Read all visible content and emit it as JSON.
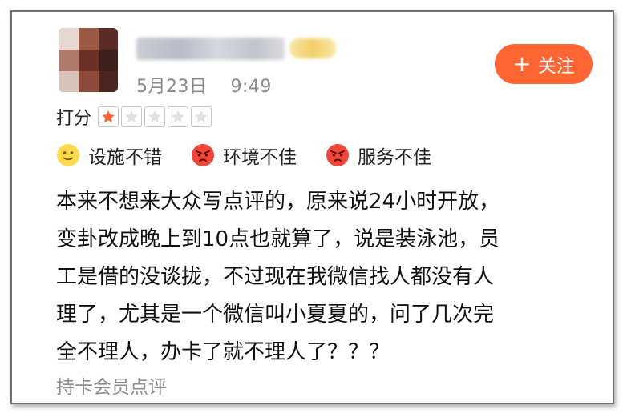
{
  "post": {
    "date": "5月23日",
    "time": "9:49"
  },
  "follow_button": {
    "label": "关注"
  },
  "rating": {
    "label": "打分",
    "stars_filled": 1,
    "stars_total": 5
  },
  "tags": [
    {
      "icon": "smile-face-icon",
      "label": "设施不错"
    },
    {
      "icon": "angry-face-icon",
      "label": "环境不佳"
    },
    {
      "icon": "angry-face-icon",
      "label": "服务不佳"
    }
  ],
  "review": {
    "lines": [
      "本来不想来大众写点评的，原来说24小时开放，",
      "变卦改成晚上到10点也就算了，说是装泳池，员",
      "工是借的没谈拢，不过现在我微信找人都没有人",
      "理了，尤其是一个微信叫小夏夏的，问了几次完",
      "全不理人，办卡了就不理人了？？？"
    ]
  },
  "footer": {
    "note": "持卡会员点评"
  },
  "colors": {
    "accent": "#ff6633",
    "star_filled": "#ff6633",
    "muted_text": "#8a8a8a"
  }
}
